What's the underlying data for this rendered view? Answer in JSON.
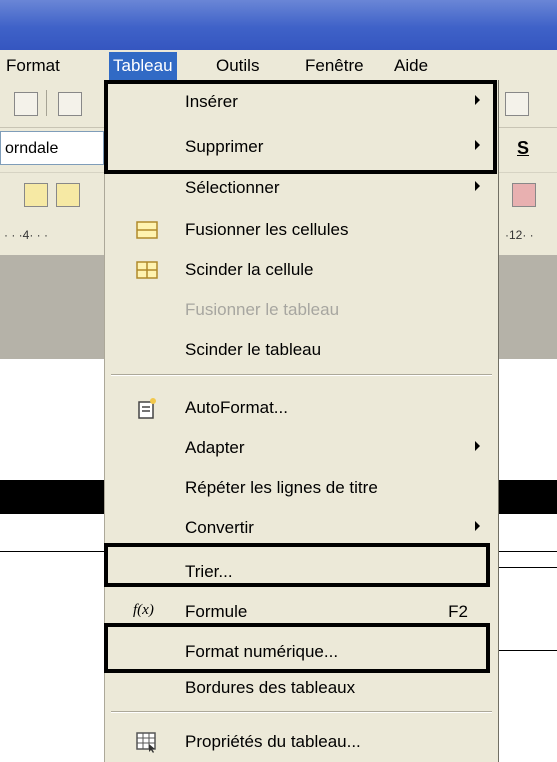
{
  "menubar": {
    "items": [
      {
        "label": "Format",
        "active": false
      },
      {
        "label": "Tableau",
        "active": true
      },
      {
        "label": "Outils",
        "active": false
      },
      {
        "label": "Fenêtre",
        "active": false
      },
      {
        "label": "Aide",
        "active": false
      }
    ]
  },
  "toolbar": {
    "font_name": "orndale",
    "underline_button": "S"
  },
  "ruler": {
    "left_marks": "· · ·4· · ·",
    "right_marks": "·12· ·"
  },
  "menu": {
    "title": "Tableau",
    "items": [
      {
        "label": "Insérer",
        "submenu": true,
        "icon": "none"
      },
      {
        "label": "Supprimer",
        "submenu": true,
        "icon": "none"
      },
      {
        "label": "Sélectionner",
        "submenu": true,
        "icon": "none"
      },
      {
        "label": "Fusionner les cellules",
        "icon": "merge-cells-icon"
      },
      {
        "label": "Scinder la cellule",
        "icon": "split-cell-icon"
      },
      {
        "label": "Fusionner le tableau",
        "disabled": true,
        "icon": "none"
      },
      {
        "label": "Scinder le tableau",
        "icon": "none"
      },
      {
        "label": "AutoFormat...",
        "icon": "autoformat-icon"
      },
      {
        "label": "Adapter",
        "submenu": true,
        "icon": "none"
      },
      {
        "label": "Répéter les lignes de titre",
        "icon": "none"
      },
      {
        "label": "Convertir",
        "submenu": true,
        "icon": "none"
      },
      {
        "label": "Trier...",
        "icon": "none"
      },
      {
        "label": "Formule",
        "shortcut": "F2",
        "icon": "formula-icon"
      },
      {
        "label": "Format numérique...",
        "icon": "none"
      },
      {
        "label": "Bordures des tableaux",
        "icon": "none"
      },
      {
        "label": "Propriétés du tableau...",
        "icon": "table-properties-icon"
      }
    ]
  },
  "colors": {
    "title_bar": "#3f62c8",
    "menu_bg": "#ece9d8",
    "menu_highlight": "#316ac5",
    "disabled_text": "#a7a6a0",
    "annotation_box": "#000000"
  }
}
